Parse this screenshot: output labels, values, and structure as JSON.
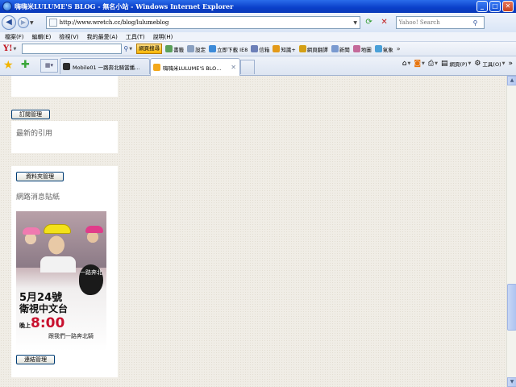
{
  "window": {
    "title": "嗨嗨米LULUME'S BLOG - 無名小站 - Windows Internet Explorer",
    "controls": {
      "minimize": "_",
      "maximize": "□",
      "close": "✕"
    }
  },
  "address_bar": {
    "url": "http://www.wretch.cc/blog/lulumeblog",
    "search_placeholder": "Yahoo! Search"
  },
  "menu": [
    "檔案(F)",
    "編輯(E)",
    "檢視(V)",
    "我的最愛(A)",
    "工具(T)",
    "說明(H)"
  ],
  "yahoo_toolbar": {
    "logo": "Y!",
    "search_button": "網頁搜尋",
    "items": [
      "書籤",
      "設定",
      "立即下載 IE8",
      "信箱",
      "知識+",
      "網頁翻譯",
      "新聞",
      "地圖",
      "氣象"
    ]
  },
  "tabs": [
    {
      "label": "Mobile01 一路奔北騎當播…",
      "active": false
    },
    {
      "label": "嗨嗨米LULUME'S BLO…",
      "active": true
    }
  ],
  "command_bar": {
    "page_label": "網頁(P)",
    "tools_label": "工具(O)"
  },
  "sidebar": {
    "trackback_manage": "訂閱管理",
    "recent_trackbacks": "最新的引用",
    "files_manage": "資料夾管理",
    "sticker_heading": "網路消息貼紙",
    "links_manage": "連結管理",
    "sticker": {
      "logo_text": "一路奔北",
      "date": "5月24號",
      "channel": "衛視中文台",
      "time_prefix": "晚上",
      "time": "8:00",
      "tagline": "跟我們一路奔北騎"
    }
  },
  "colors": {
    "titlebar": "#0a3fc9",
    "content_bg": "#f0ede6",
    "panel_bg": "#ffffff",
    "time_red": "#c8102e"
  }
}
